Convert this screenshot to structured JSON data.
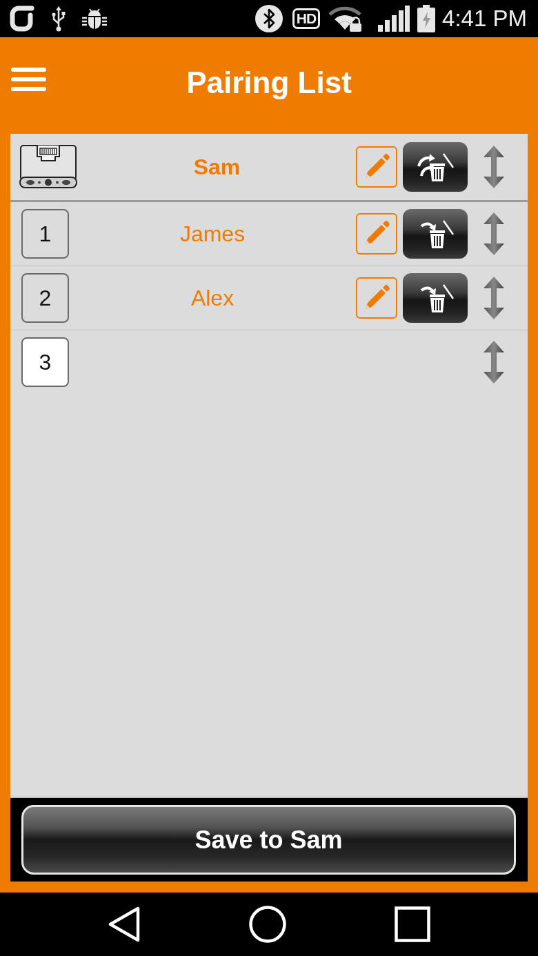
{
  "status_bar": {
    "hd_badge": "HD",
    "time": "4:41 PM"
  },
  "app_bar": {
    "title": "Pairing List"
  },
  "device": {
    "name": "Sam"
  },
  "slots": [
    {
      "number": "1",
      "name": "James",
      "kind": "paired",
      "selected": false
    },
    {
      "number": "2",
      "name": "Alex",
      "kind": "paired",
      "selected": false
    },
    {
      "number": "3",
      "kind": "empty",
      "selected": true
    }
  ],
  "save_button": {
    "label": "Save to Sam"
  }
}
